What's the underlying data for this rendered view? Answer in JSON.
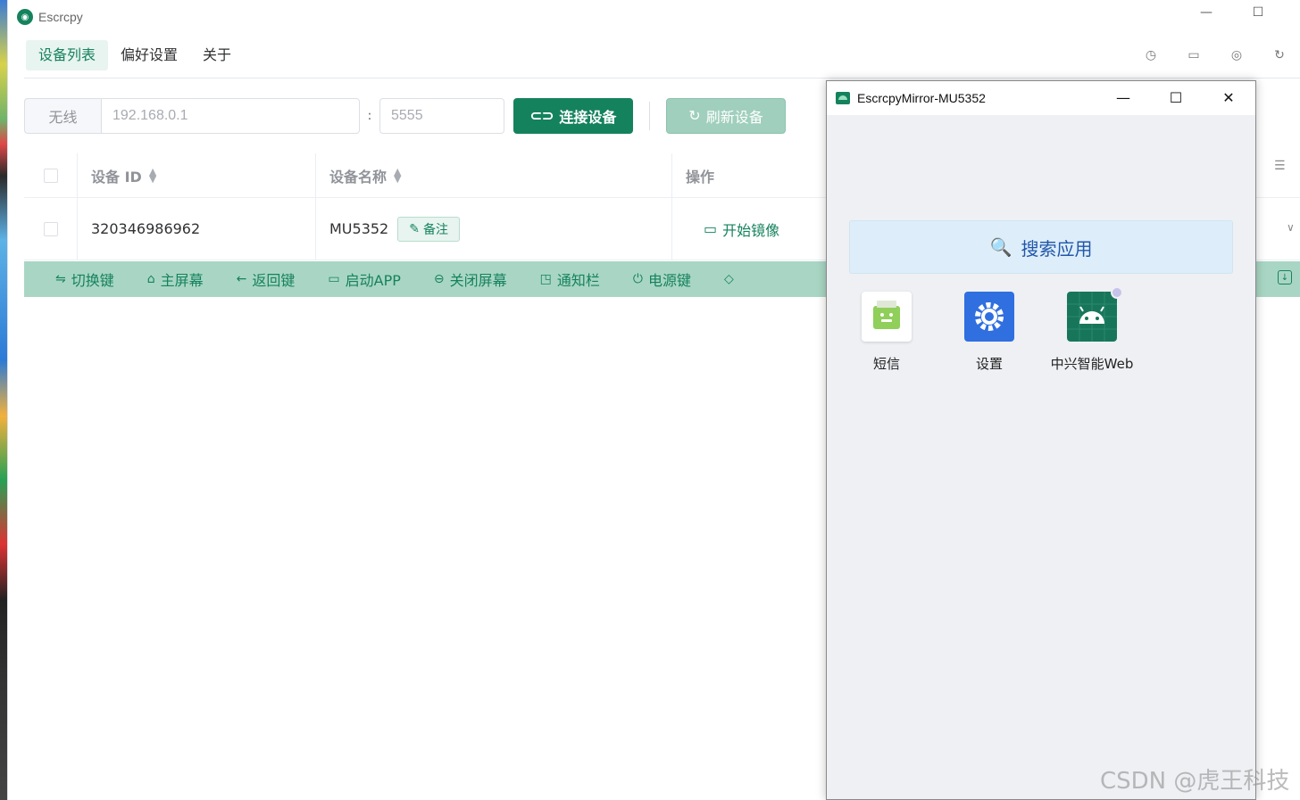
{
  "window": {
    "title": "Escrcpy"
  },
  "nav": {
    "tabs": [
      {
        "label": "设备列表"
      },
      {
        "label": "偏好设置"
      },
      {
        "label": "关于"
      }
    ]
  },
  "connection": {
    "prefix": "无线",
    "ip_placeholder": "192.168.0.1",
    "colon": ":",
    "port_placeholder": "5555",
    "connect_label": "连接设备",
    "refresh_label": "刷新设备"
  },
  "table": {
    "headers": {
      "id": "设备 ID",
      "name": "设备名称",
      "ops": "操作"
    },
    "rows": [
      {
        "id": "320346986962",
        "name": "MU5352",
        "remark_label": "备注",
        "mirror_label": "开始镜像"
      }
    ]
  },
  "controls": [
    {
      "label": "切换键",
      "icon": "switch-icon"
    },
    {
      "label": "主屏幕",
      "icon": "home-icon"
    },
    {
      "label": "返回键",
      "icon": "back-arrow-icon"
    },
    {
      "label": "启动APP",
      "icon": "app-icon"
    },
    {
      "label": "关闭屏幕",
      "icon": "toggle-icon"
    },
    {
      "label": "通知栏",
      "icon": "notification-icon"
    },
    {
      "label": "电源键",
      "icon": "power-icon"
    }
  ],
  "mirror": {
    "title": "EscrcpyMirror-MU5352",
    "search_label": "搜索应用",
    "apps": [
      {
        "label": "短信"
      },
      {
        "label": "设置"
      },
      {
        "label": "中兴智能Web"
      }
    ]
  },
  "watermark": "CSDN @虎王科技",
  "colors": {
    "accent": "#15825e",
    "control_bar": "#a9d6c4",
    "search_bg": "#ddeefa"
  }
}
